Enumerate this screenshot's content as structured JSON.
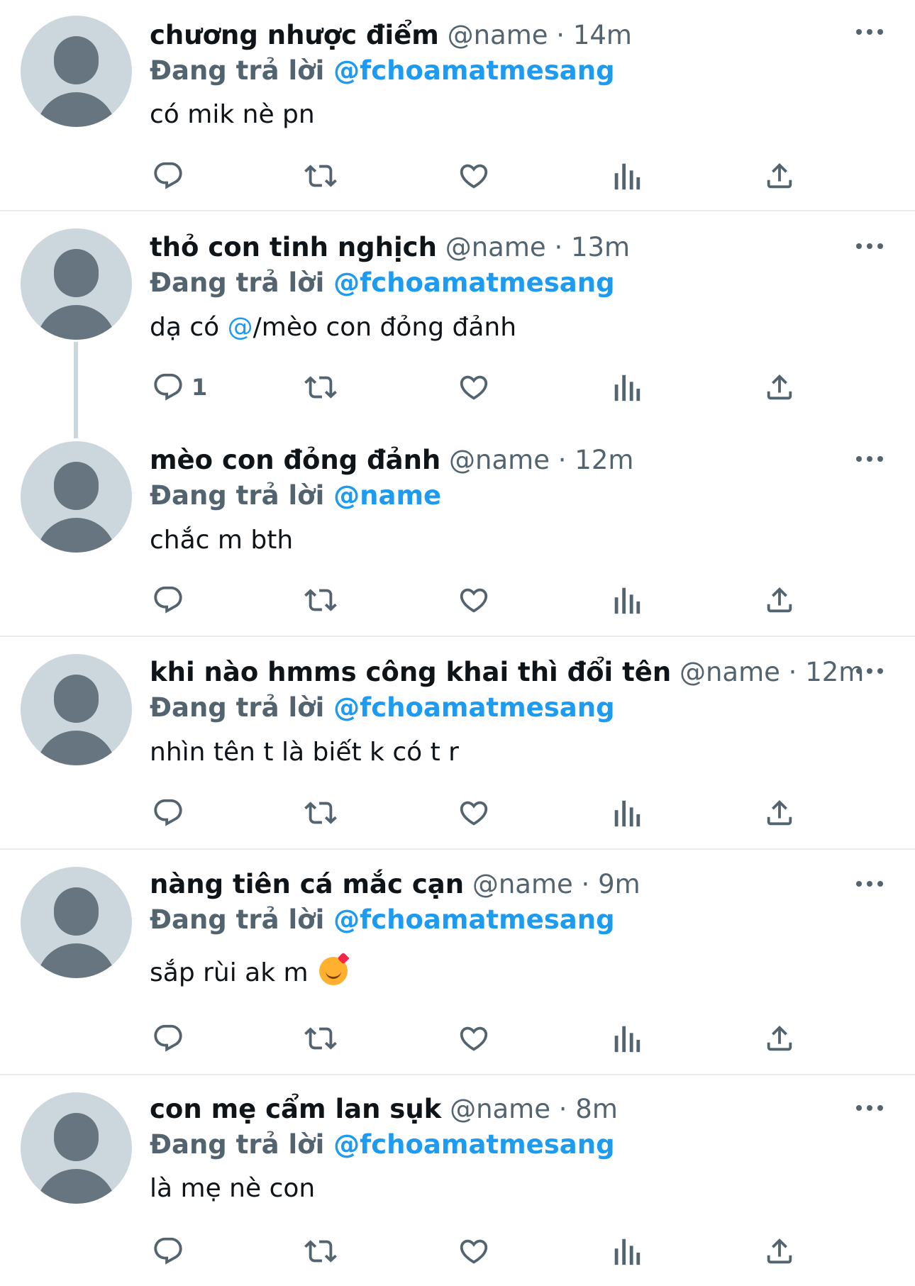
{
  "reply_prefix": "Đang trả lời",
  "dot": "·",
  "tweets": [
    {
      "display_name": "chương nhược điểm",
      "handle": "@name",
      "time": "14m",
      "reply_to": "@fchoamatmesang",
      "text": "có mik nè pn",
      "reply_count": ""
    },
    {
      "display_name": "thỏ con tinh nghịch",
      "handle": "@name",
      "time": "13m",
      "reply_to": "@fchoamatmesang",
      "text_before": "dạ có ",
      "text_mention": "@",
      "text_after": "/mèo con đỏng đảnh",
      "reply_count": "1"
    },
    {
      "display_name": "mèo con đỏng đảnh",
      "handle": "@name",
      "time": "12m",
      "reply_to": "@name",
      "text": "chắc m bth",
      "reply_count": ""
    },
    {
      "display_name": "khi nào hmms công khai thì đổi tên",
      "handle": "@name",
      "time": "12m",
      "reply_to": "@fchoamatmesang",
      "text": "nhìn tên t là biết k có t r",
      "reply_count": ""
    },
    {
      "display_name": "nàng tiên cá mắc cạn",
      "handle": "@name",
      "time": "9m",
      "reply_to": "@fchoamatmesang",
      "text": "sắp rùi ak m",
      "emoji": "smiling-face-with-hearts",
      "reply_count": ""
    },
    {
      "display_name": "con mẹ cẩm lan sụk",
      "handle": "@name",
      "time": "8m",
      "reply_to": "@fchoamatmesang",
      "text": "là mẹ nè con",
      "reply_count": ""
    }
  ],
  "icons": {
    "reply": "reply-icon",
    "retweet": "retweet-icon",
    "like": "like-icon",
    "views": "views-icon",
    "share": "share-icon",
    "more": "more-icon"
  },
  "colors": {
    "link": "#1d9bf0",
    "secondary": "#536471",
    "avatar_bg": "#ccd6dd",
    "avatar_fg": "#66757f",
    "divider": "#e6ecf0"
  }
}
